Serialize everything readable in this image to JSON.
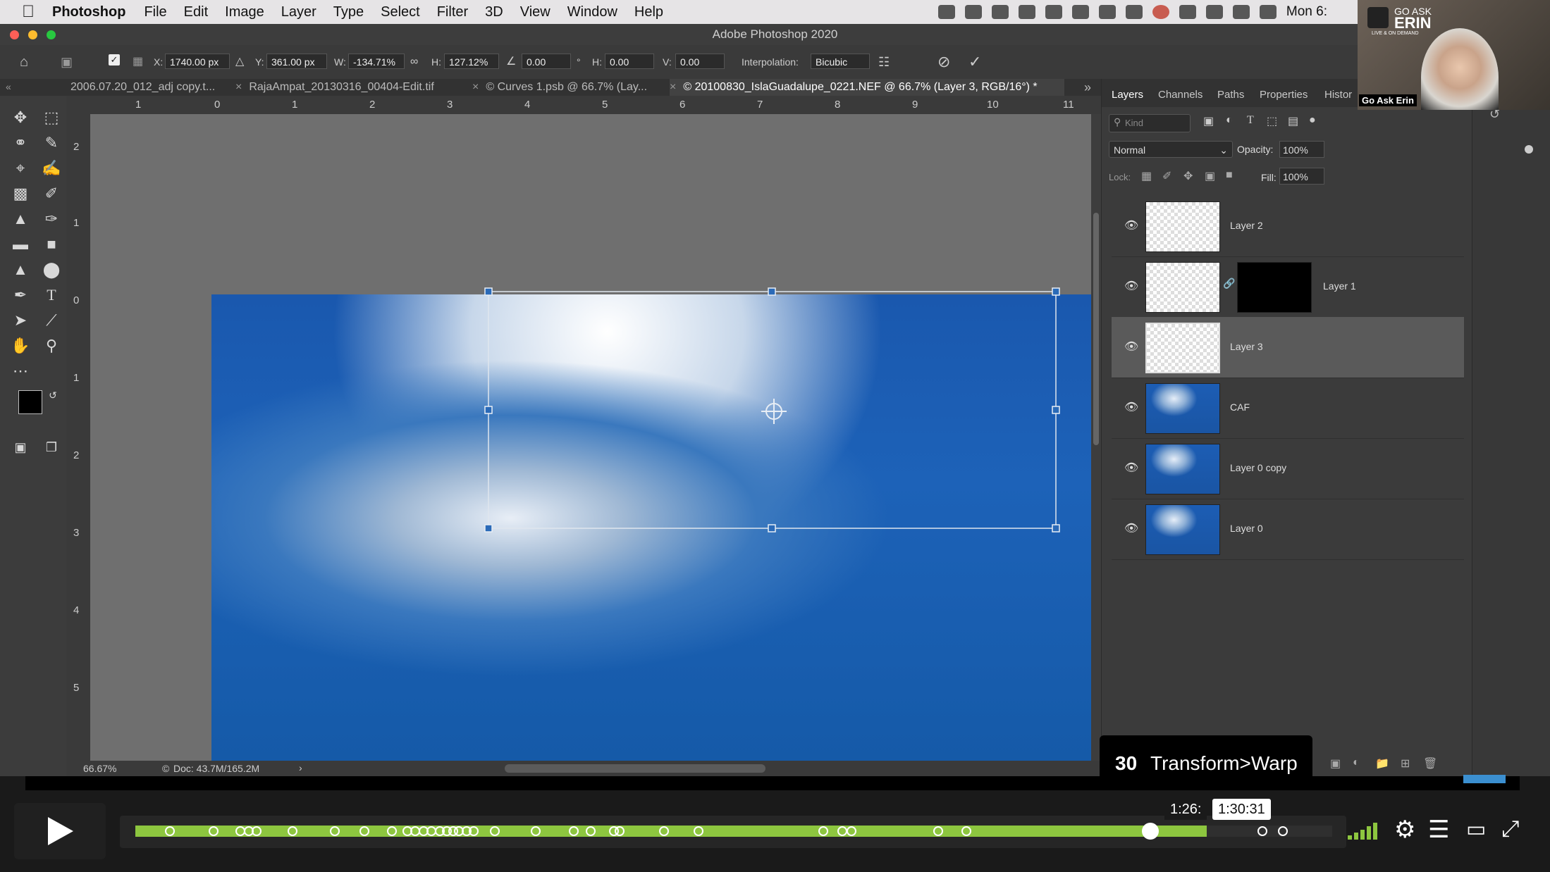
{
  "menubar": {
    "app": "Photoshop",
    "items": [
      "File",
      "Edit",
      "Image",
      "Layer",
      "Type",
      "Select",
      "Filter",
      "3D",
      "View",
      "Window",
      "Help"
    ],
    "clock": "Mon 6:"
  },
  "window": {
    "title": "Adobe Photoshop 2020"
  },
  "options": {
    "x_label": "X:",
    "x_value": "1740.00 px",
    "y_label": "Y:",
    "y_value": "361.00 px",
    "w_label": "W:",
    "w_value": "-134.71%",
    "h_label": "H:",
    "h_value": "127.12%",
    "angle_value": "0.00",
    "hskew_label": "H:",
    "hskew_value": "0.00",
    "vskew_label": "V:",
    "vskew_value": "0.00",
    "interp_label": "Interpolation:",
    "interp_value": "Bicubic"
  },
  "tabs": [
    "2006.07.20_012_adj copy.t...",
    "RajaAmpat_20130316_00404-Edit.tif",
    "© Curves 1.psb @ 66.7% (Lay...",
    "© 20100830_IslaGuadalupe_0221.NEF @ 66.7% (Layer 3, RGB/16°) *"
  ],
  "ruler": {
    "h": [
      "1",
      "0",
      "1",
      "2",
      "3",
      "4",
      "5",
      "6",
      "7",
      "8",
      "9",
      "10",
      "11"
    ],
    "v": [
      "2",
      "1",
      "0",
      "1",
      "2",
      "3",
      "4",
      "5"
    ]
  },
  "status": {
    "zoom": "66.67%",
    "doc": "Doc: 43.7M/165.2M"
  },
  "panels": {
    "tabs": [
      "Layers",
      "Channels",
      "Paths",
      "Properties",
      "Histor"
    ],
    "kind_placeholder": "Kind",
    "blend_mode": "Normal",
    "opacity_label": "Opacity:",
    "opacity_value": "100%",
    "lock_label": "Lock:",
    "fill_label": "Fill:",
    "fill_value": "100%",
    "layers": [
      {
        "name": "Layer 2"
      },
      {
        "name": "Layer 1"
      },
      {
        "name": "Layer 3"
      },
      {
        "name": "CAF"
      },
      {
        "name": "Layer 0 copy"
      },
      {
        "name": "Layer 0"
      }
    ]
  },
  "webcam": {
    "brand_top": "GO ASK",
    "brand_name": "ERIN",
    "brand_sub": "LIVE & ON DEMAND",
    "caption": "Go Ask Erin"
  },
  "video": {
    "chapter_number": "30",
    "chapter_title": "Transform>Warp",
    "time_hover": "1:26:",
    "time_total": "1:30:31",
    "progress": 0.895,
    "accent": "#8dc63f",
    "markers": [
      0.028,
      0.065,
      0.087,
      0.094,
      0.101,
      0.131,
      0.166,
      0.191,
      0.214,
      0.227,
      0.233,
      0.24,
      0.247,
      0.254,
      0.26,
      0.265,
      0.27,
      0.276,
      0.282,
      0.3,
      0.334,
      0.366,
      0.38,
      0.399,
      0.404,
      0.441,
      0.47,
      0.574,
      0.59,
      0.598,
      0.67,
      0.694
    ],
    "markers_after": [
      0.941,
      0.958
    ]
  }
}
